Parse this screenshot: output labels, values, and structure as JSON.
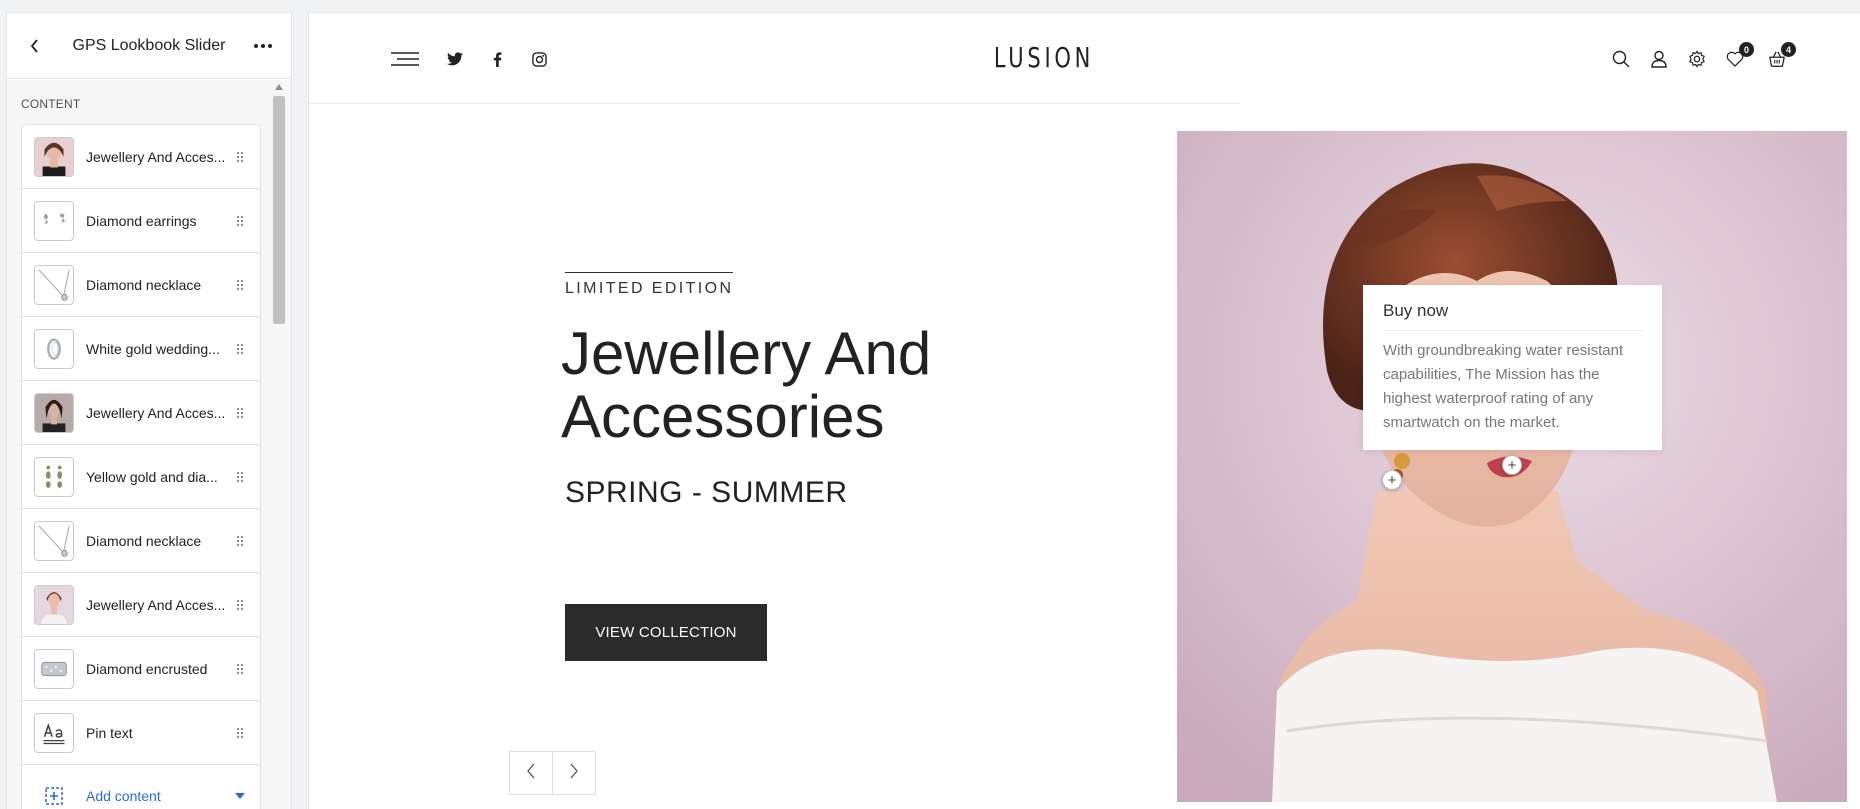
{
  "sidebar": {
    "title": "GPS Lookbook Slider",
    "section_label": "CONTENT",
    "items": [
      {
        "label": "Jewellery And Acces...",
        "thumb": "portrait-woman"
      },
      {
        "label": "Diamond earrings",
        "thumb": "earrings"
      },
      {
        "label": "Diamond necklace",
        "thumb": "necklace"
      },
      {
        "label": "White gold wedding...",
        "thumb": "ring"
      },
      {
        "label": "Jewellery And Acces...",
        "thumb": "portrait-woman-dark"
      },
      {
        "label": "Yellow gold and dia...",
        "thumb": "drop-earrings"
      },
      {
        "label": "Diamond necklace",
        "thumb": "necklace"
      },
      {
        "label": "Jewellery And Acces...",
        "thumb": "portrait-woman-pink"
      },
      {
        "label": "Diamond encrusted",
        "thumb": "bracelet"
      },
      {
        "label": "Pin text",
        "thumb": "text-format"
      }
    ],
    "add_content_label": "Add content"
  },
  "preview": {
    "logo": "LUSION",
    "badges": {
      "wishlist": "0",
      "cart": "4"
    },
    "hero": {
      "eyebrow": "LIMITED EDITION",
      "headline": "Jewellery And Accessories",
      "subhead": "SPRING - SUMMER",
      "cta_label": "VIEW COLLECTION"
    },
    "popup": {
      "title": "Buy now",
      "text": "With groundbreaking water resistant capabilities, The Mission has the highest waterproof rating of any smartwatch on the market."
    },
    "pin_symbol": "+"
  },
  "colors": {
    "accent": "#2c6ecb",
    "button_dark": "#2b2b2b",
    "photo_bg": "#dbc6d1"
  }
}
